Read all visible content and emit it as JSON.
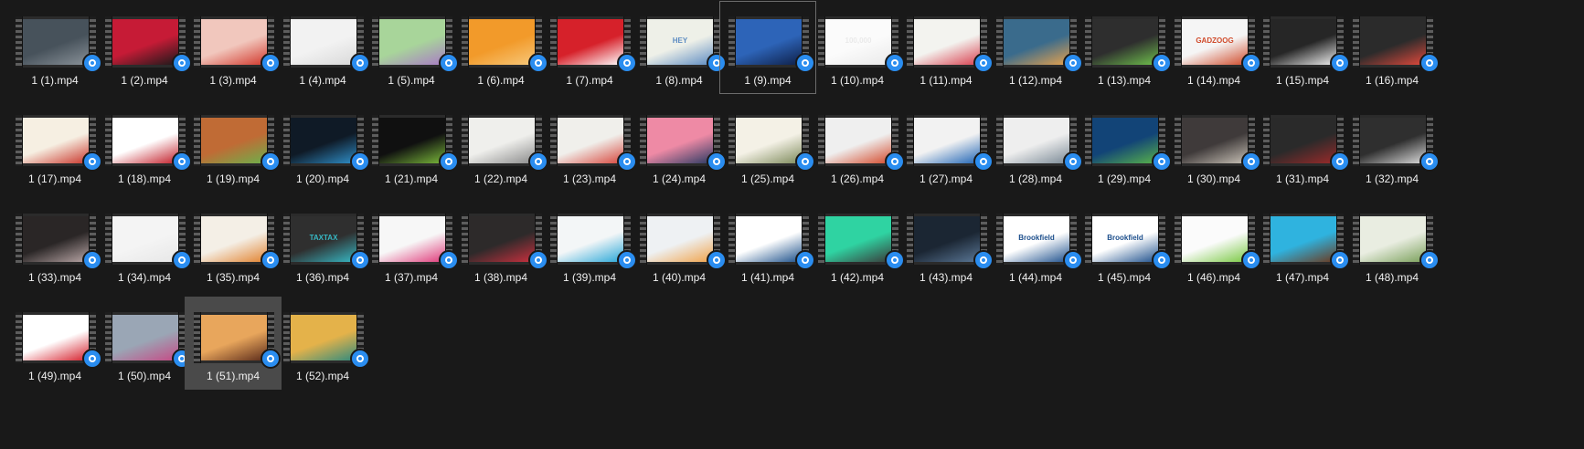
{
  "window": {
    "view": "large-icons",
    "background": "#191919"
  },
  "badge_icon": "video-player-icon",
  "selected_file": "1 (51).mp4",
  "hovered_file": "1 (9).mp4",
  "files": [
    {
      "name": "1 (1).mp4",
      "colors": [
        "#47525b",
        "#8a9299"
      ]
    },
    {
      "name": "1 (2).mp4",
      "colors": [
        "#c61b36",
        "#1a1a1a"
      ]
    },
    {
      "name": "1 (3).mp4",
      "colors": [
        "#f1c7bd",
        "#d2382c"
      ]
    },
    {
      "name": "1 (4).mp4",
      "colors": [
        "#f2f2f2",
        "#d9d9d9"
      ]
    },
    {
      "name": "1 (5).mp4",
      "colors": [
        "#a8d59a",
        "#a97cc5"
      ]
    },
    {
      "name": "1 (6).mp4",
      "colors": [
        "#f29a2a",
        "#f7c87b"
      ]
    },
    {
      "name": "1 (7).mp4",
      "colors": [
        "#d6212a",
        "#ffffff"
      ]
    },
    {
      "name": "1 (8).mp4",
      "colors": [
        "#eef0e8",
        "#5d8cc2"
      ],
      "text": "HEY"
    },
    {
      "name": "1 (9).mp4",
      "colors": [
        "#2d64b8",
        "#0e1f48"
      ]
    },
    {
      "name": "1 (10).mp4",
      "colors": [
        "#fbfbfb",
        "#eaeaea"
      ],
      "text": "100,000"
    },
    {
      "name": "1 (11).mp4",
      "colors": [
        "#f3f3ef",
        "#d9404f"
      ]
    },
    {
      "name": "1 (12).mp4",
      "colors": [
        "#3a6b8c",
        "#e7a24d"
      ]
    },
    {
      "name": "1 (13).mp4",
      "colors": [
        "#2e2e2e",
        "#6fc04c"
      ]
    },
    {
      "name": "1 (14).mp4",
      "colors": [
        "#f5f5f5",
        "#d04a2a"
      ],
      "text": "GADZOOG"
    },
    {
      "name": "1 (15).mp4",
      "colors": [
        "#262626",
        "#f0f0f0"
      ]
    },
    {
      "name": "1 (16).mp4",
      "colors": [
        "#2b2b2b",
        "#e2493c"
      ]
    },
    {
      "name": "1 (17).mp4",
      "colors": [
        "#f6efe2",
        "#c9362b"
      ]
    },
    {
      "name": "1 (18).mp4",
      "colors": [
        "#ffffff",
        "#c21f2a"
      ]
    },
    {
      "name": "1 (19).mp4",
      "colors": [
        "#c06b35",
        "#6db04b"
      ]
    },
    {
      "name": "1 (20).mp4",
      "colors": [
        "#0f1a26",
        "#2f8fc9"
      ]
    },
    {
      "name": "1 (21).mp4",
      "colors": [
        "#101010",
        "#7ab83a"
      ]
    },
    {
      "name": "1 (22).mp4",
      "colors": [
        "#efefec",
        "#8b8b8b"
      ]
    },
    {
      "name": "1 (23).mp4",
      "colors": [
        "#f0efeb",
        "#d8473d"
      ]
    },
    {
      "name": "1 (24).mp4",
      "colors": [
        "#ee8aa5",
        "#2a3a63"
      ]
    },
    {
      "name": "1 (25).mp4",
      "colors": [
        "#f4f1e6",
        "#7d8a5a"
      ]
    },
    {
      "name": "1 (26).mp4",
      "colors": [
        "#efefef",
        "#d44a2c"
      ]
    },
    {
      "name": "1 (27).mp4",
      "colors": [
        "#f2f2f2",
        "#1f64b5"
      ]
    },
    {
      "name": "1 (28).mp4",
      "colors": [
        "#eeeeee",
        "#7b8a96"
      ]
    },
    {
      "name": "1 (29).mp4",
      "colors": [
        "#124477",
        "#58b24a"
      ]
    },
    {
      "name": "1 (30).mp4",
      "colors": [
        "#3f3a3a",
        "#c8c1b6"
      ]
    },
    {
      "name": "1 (31).mp4",
      "colors": [
        "#2a2a2a",
        "#9b2a2a"
      ]
    },
    {
      "name": "1 (32).mp4",
      "colors": [
        "#2f2f2f",
        "#dcdcdc"
      ]
    },
    {
      "name": "1 (33).mp4",
      "colors": [
        "#2a2626",
        "#b9a6a6"
      ]
    },
    {
      "name": "1 (34).mp4",
      "colors": [
        "#f4f4f4",
        "#e7e7e7"
      ]
    },
    {
      "name": "1 (35).mp4",
      "colors": [
        "#f4efe6",
        "#e2832f"
      ]
    },
    {
      "name": "1 (36).mp4",
      "colors": [
        "#2f2f2f",
        "#37b8c4"
      ],
      "text": "TAXTAX"
    },
    {
      "name": "1 (37).mp4",
      "colors": [
        "#f7f7f7",
        "#e03a7a"
      ]
    },
    {
      "name": "1 (38).mp4",
      "colors": [
        "#2d2a2a",
        "#c9303e"
      ]
    },
    {
      "name": "1 (39).mp4",
      "colors": [
        "#f3f6f7",
        "#28a7d8"
      ]
    },
    {
      "name": "1 (40).mp4",
      "colors": [
        "#eef1f3",
        "#f0a34a"
      ]
    },
    {
      "name": "1 (41).mp4",
      "colors": [
        "#ffffff",
        "#1b4f8a"
      ]
    },
    {
      "name": "1 (42).mp4",
      "colors": [
        "#2fd3a2",
        "#3a3a3a"
      ]
    },
    {
      "name": "1 (43).mp4",
      "colors": [
        "#1b2633",
        "#5a7796"
      ]
    },
    {
      "name": "1 (44).mp4",
      "colors": [
        "#ffffff",
        "#1d4f8c"
      ],
      "text": "Brookfield"
    },
    {
      "name": "1 (45).mp4",
      "colors": [
        "#ffffff",
        "#1d4f8c"
      ],
      "text": "Brookfield"
    },
    {
      "name": "1 (46).mp4",
      "colors": [
        "#fbfbfb",
        "#7ac943"
      ]
    },
    {
      "name": "1 (47).mp4",
      "colors": [
        "#2fb3df",
        "#6b3a1f"
      ]
    },
    {
      "name": "1 (48).mp4",
      "colors": [
        "#e9ede1",
        "#7aa05a"
      ]
    },
    {
      "name": "1 (49).mp4",
      "colors": [
        "#ffffff",
        "#d51f2b"
      ]
    },
    {
      "name": "1 (50).mp4",
      "colors": [
        "#9aa6b5",
        "#c64a85"
      ]
    },
    {
      "name": "1 (51).mp4",
      "colors": [
        "#e8a65c",
        "#5b2b1a"
      ]
    },
    {
      "name": "1 (52).mp4",
      "colors": [
        "#e4b24a",
        "#2f8a7e"
      ]
    }
  ]
}
